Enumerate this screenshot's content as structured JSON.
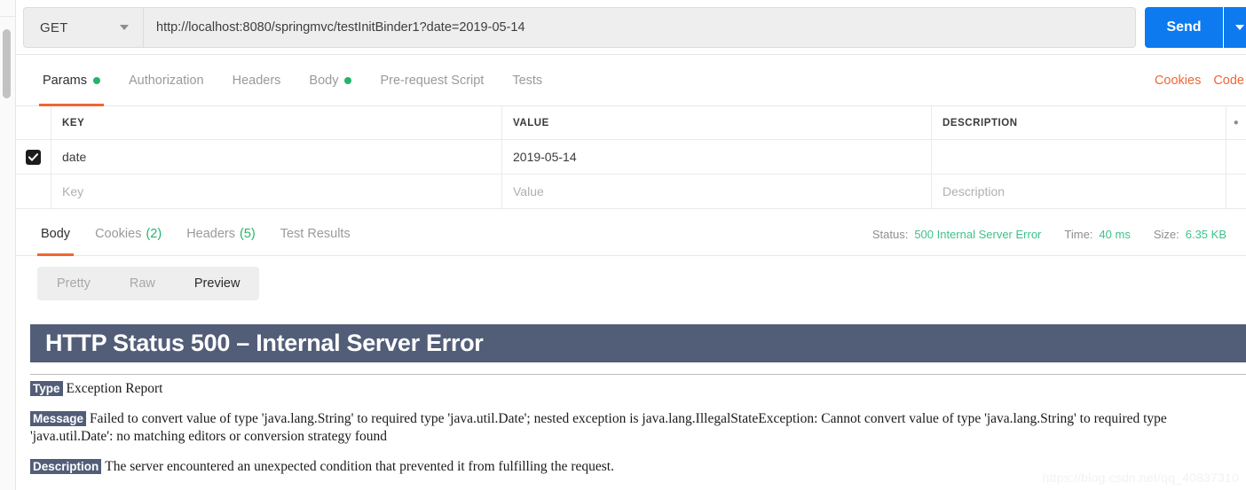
{
  "request": {
    "method": "GET",
    "method_caret_icon": "chevron-down-icon",
    "url": "http://localhost:8080/springmvc/testInitBinder1?date=2019-05-14",
    "url_placeholder": "Enter request URL",
    "send_label": "Send",
    "send_caret_icon": "chevron-down-icon",
    "send_color": "#0d7aef"
  },
  "request_tabs": {
    "items": [
      {
        "label": "Params",
        "dot": true,
        "active": true
      },
      {
        "label": "Authorization",
        "dot": false,
        "active": false
      },
      {
        "label": "Headers",
        "dot": false,
        "active": false
      },
      {
        "label": "Body",
        "dot": true,
        "active": false
      },
      {
        "label": "Pre-request Script",
        "dot": false,
        "active": false
      },
      {
        "label": "Tests",
        "dot": false,
        "active": false
      }
    ],
    "right_links": [
      "Cookies",
      "Code"
    ],
    "accent": "#f06634",
    "dot_color": "#26b36b"
  },
  "params_table": {
    "headers": [
      "KEY",
      "VALUE",
      "DESCRIPTION"
    ],
    "options_icon": "ellipsis-icon",
    "rows": [
      {
        "checked": true,
        "key": "date",
        "value": "2019-05-14",
        "description": ""
      }
    ],
    "placeholder_row": {
      "key": "Key",
      "value": "Value",
      "description": "Description"
    }
  },
  "response_tabs": {
    "items": [
      {
        "label": "Body",
        "count": "",
        "active": true
      },
      {
        "label": "Cookies",
        "count": "(2)",
        "active": false
      },
      {
        "label": "Headers",
        "count": "(5)",
        "active": false
      },
      {
        "label": "Test Results",
        "count": "",
        "active": false
      }
    ],
    "meta": {
      "status_label": "Status:",
      "status_value": "500 Internal Server Error",
      "time_label": "Time:",
      "time_value": "40 ms",
      "size_label": "Size:",
      "size_value": "6.35 KB",
      "value_color": "#3ec28a"
    }
  },
  "body_view": {
    "modes": [
      {
        "label": "Pretty",
        "active": false
      },
      {
        "label": "Raw",
        "active": false
      },
      {
        "label": "Preview",
        "active": true
      }
    ]
  },
  "error_page": {
    "title": "HTTP Status 500 – Internal Server Error",
    "banner_color": "#525d78",
    "type_label": "Type",
    "type_value": "Exception Report",
    "message_label": "Message",
    "message_value": "Failed to convert value of type 'java.lang.String' to required type 'java.util.Date'; nested exception is java.lang.IllegalStateException: Cannot convert value of type 'java.lang.String' to required type 'java.util.Date': no matching editors or conversion strategy found",
    "description_label": "Description",
    "description_value": "The server encountered an unexpected condition that prevented it from fulfilling the request."
  },
  "watermark": "https://blog.csdn.net/qq_40837310"
}
